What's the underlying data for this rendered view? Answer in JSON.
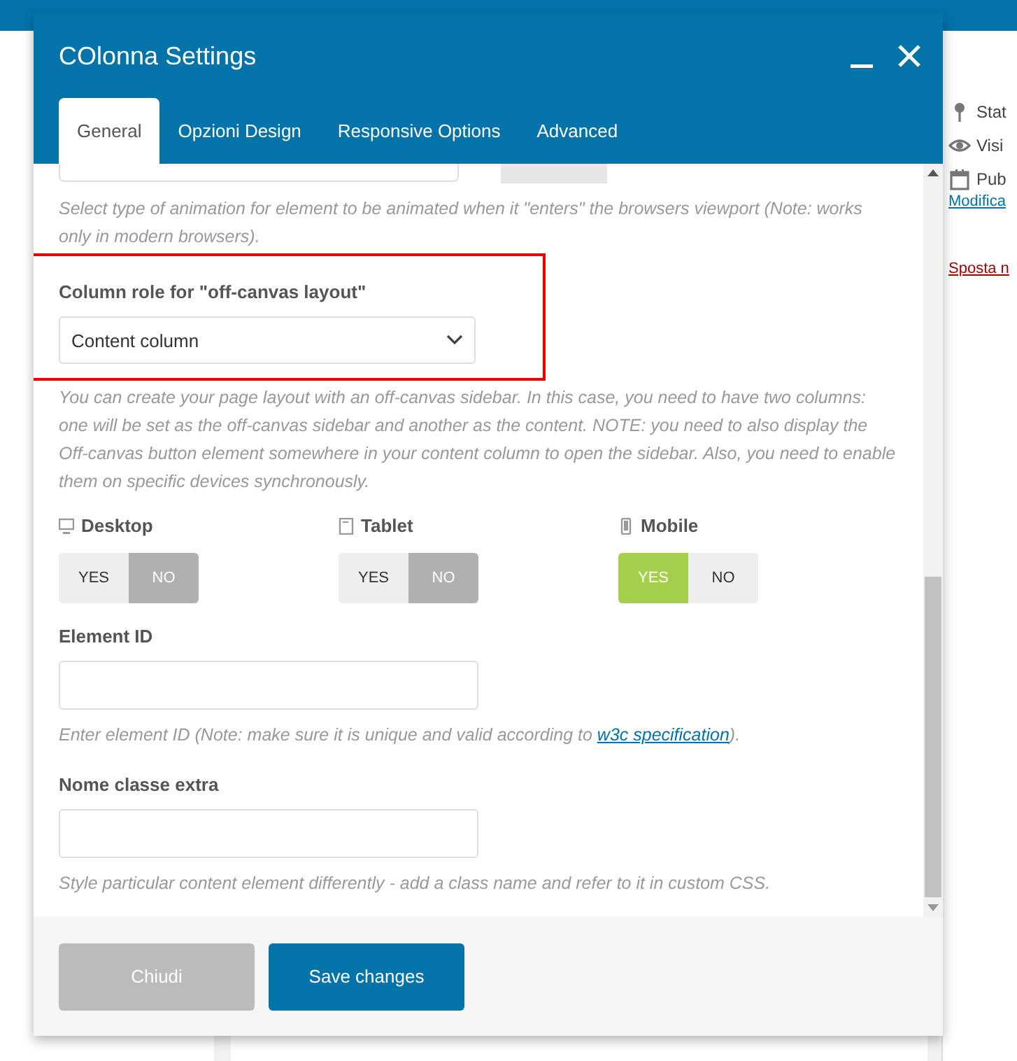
{
  "background": {
    "sidebar_items": [
      {
        "label": "Stat"
      },
      {
        "label": "Visi"
      },
      {
        "label": "Pub"
      }
    ],
    "edit_link": "Modifica",
    "trash_link": "Sposta n"
  },
  "dialog": {
    "title": "COlonna Settings",
    "tabs": [
      {
        "label": "General",
        "selected": true
      },
      {
        "label": "Opzioni Design",
        "selected": false
      },
      {
        "label": "Responsive Options",
        "selected": false
      },
      {
        "label": "Advanced",
        "selected": false
      }
    ],
    "animation_help": "Select type of animation for element to be animated when it \"enters\" the browsers viewport (Note: works only in modern browsers).",
    "column_role": {
      "label": "Column role for \"off-canvas layout\"",
      "value": "Content column",
      "highlighted": true,
      "help": "You can create your page layout with an off-canvas sidebar. In this case, you need to have two columns: one will be set as the off-canvas sidebar and another as the content. NOTE: you need to also display the Off-canvas button element somewhere in your content column to open the sidebar. Also, you need to enable them on specific devices synchronously."
    },
    "devices": [
      {
        "kind": "desktop",
        "label": "Desktop",
        "options": [
          {
            "label": "YES",
            "selected": false
          },
          {
            "label": "NO",
            "selected": true
          }
        ]
      },
      {
        "kind": "tablet",
        "label": "Tablet",
        "options": [
          {
            "label": "YES",
            "selected": false
          },
          {
            "label": "NO",
            "selected": true
          }
        ]
      },
      {
        "kind": "mobile",
        "label": "Mobile",
        "options": [
          {
            "label": "YES",
            "selected": true
          },
          {
            "label": "NO",
            "selected": false
          }
        ]
      }
    ],
    "element_id": {
      "label": "Element ID",
      "help_before": "Enter element ID (Note: make sure it is unique and valid according to ",
      "link": "w3c specification",
      "help_after": ")."
    },
    "extra_class": {
      "label": "Nome classe extra",
      "help": "Style particular content element differently - add a class name and refer to it in custom CSS."
    },
    "buttons": [
      {
        "kind": "secondary",
        "label": "Chiudi"
      },
      {
        "kind": "primary",
        "label": "Save changes"
      }
    ]
  }
}
